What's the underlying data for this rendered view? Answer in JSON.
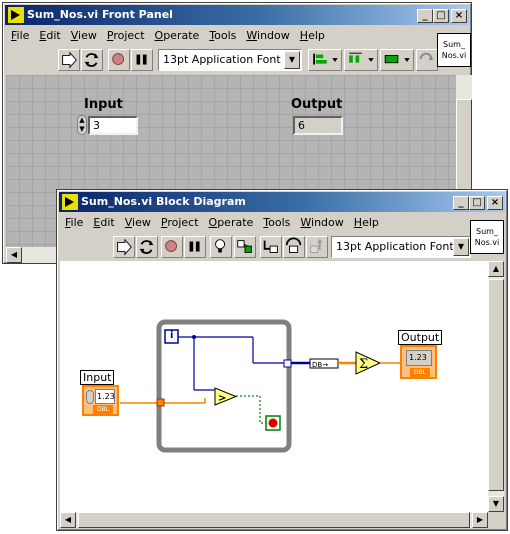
{
  "front_panel": {
    "title": "Sum_Nos.vi Front Panel",
    "menu": [
      {
        "label": "File",
        "key": "F",
        "rest": "ile"
      },
      {
        "label": "Edit",
        "key": "E",
        "rest": "dit"
      },
      {
        "label": "View",
        "key": "V",
        "rest": "iew"
      },
      {
        "label": "Project",
        "key": "P",
        "rest": "roject"
      },
      {
        "label": "Operate",
        "key": "O",
        "rest": "perate"
      },
      {
        "label": "Tools",
        "key": "T",
        "rest": "ools"
      },
      {
        "label": "Window",
        "key": "W",
        "rest": "indow"
      },
      {
        "label": "Help",
        "key": "H",
        "rest": "elp"
      }
    ],
    "font": "13pt Application Font",
    "vi_icon": {
      "line1": "Sum_",
      "line2": "Nos.vi"
    },
    "input": {
      "label": "Input",
      "value": "3"
    },
    "output": {
      "label": "Output",
      "value": "6"
    }
  },
  "block_diagram": {
    "title": "Sum_Nos.vi Block Diagram",
    "menu": [
      {
        "label": "File",
        "key": "F",
        "rest": "ile"
      },
      {
        "label": "Edit",
        "key": "E",
        "rest": "dit"
      },
      {
        "label": "View",
        "key": "V",
        "rest": "iew"
      },
      {
        "label": "Project",
        "key": "P",
        "rest": "roject"
      },
      {
        "label": "Operate",
        "key": "O",
        "rest": "perate"
      },
      {
        "label": "Tools",
        "key": "T",
        "rest": "ools"
      },
      {
        "label": "Window",
        "key": "W",
        "rest": "indow"
      },
      {
        "label": "Help",
        "key": "H",
        "rest": "elp"
      }
    ],
    "font": "13pt Application Font",
    "vi_icon": {
      "line1": "Sum_",
      "line2": "Nos.vi"
    },
    "input_terminal": {
      "label": "Input",
      "text": "1.23",
      "type": "DBL"
    },
    "output_terminal": {
      "label": "Output",
      "text": "1.23",
      "type": "DBL"
    },
    "iteration_terminal": "i",
    "colors": {
      "orange_wire": "#ff8000",
      "blue_wire": "#0000a0",
      "green_wire": "#008000",
      "while_loop": "#808080"
    }
  }
}
